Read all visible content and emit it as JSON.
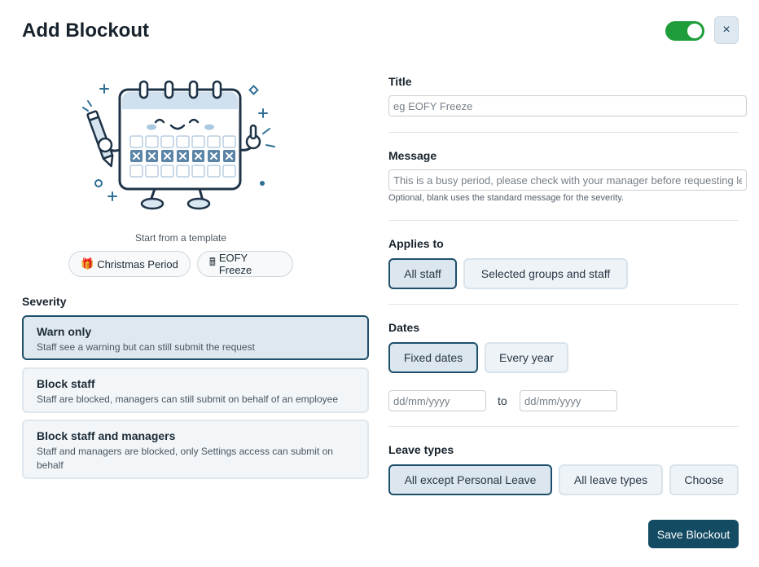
{
  "header": {
    "title": "Add Blockout",
    "toggle_enabled": true,
    "close_label": "×"
  },
  "colors": {
    "accent": "#134b63",
    "toggle_on": "#1f9d3a",
    "selected_border": "#1e4f6b"
  },
  "templates": {
    "caption": "Start from a template",
    "items": [
      {
        "icon": "gift-icon",
        "glyph": "🎁",
        "label": "Christmas Period"
      },
      {
        "icon": "calculator-icon",
        "glyph": "🖩",
        "label": "EOFY Freeze"
      }
    ]
  },
  "severity": {
    "label": "Severity",
    "options": [
      {
        "title": "Warn only",
        "description": "Staff see a warning but can still submit the request",
        "selected": true
      },
      {
        "title": "Block staff",
        "description": "Staff are blocked, managers can still submit on behalf of an employee",
        "selected": false
      },
      {
        "title": "Block staff and managers",
        "description": "Staff and managers are blocked, only Settings access can submit on behalf",
        "selected": false
      }
    ]
  },
  "title_field": {
    "label": "Title",
    "placeholder": "eg EOFY Freeze",
    "value": ""
  },
  "message_field": {
    "label": "Message",
    "placeholder": "This is a busy period, please check with your manager before requesting leave.",
    "value": "",
    "hint": "Optional, blank uses the standard message for the severity."
  },
  "applies_to": {
    "label": "Applies to",
    "options": [
      {
        "label": "All staff",
        "selected": true
      },
      {
        "label": "Selected groups and staff",
        "selected": false
      }
    ]
  },
  "dates": {
    "label": "Dates",
    "options": [
      {
        "label": "Fixed dates",
        "selected": true
      },
      {
        "label": "Every year",
        "selected": false
      }
    ],
    "from_placeholder": "dd/mm/yyyy",
    "to_label": "to",
    "to_placeholder": "dd/mm/yyyy"
  },
  "leave_types": {
    "label": "Leave types",
    "options": [
      {
        "label": "All except Personal Leave",
        "selected": true
      },
      {
        "label": "All leave types",
        "selected": false
      },
      {
        "label": "Choose",
        "selected": false
      }
    ]
  },
  "footer": {
    "save_label": "Save Blockout"
  }
}
